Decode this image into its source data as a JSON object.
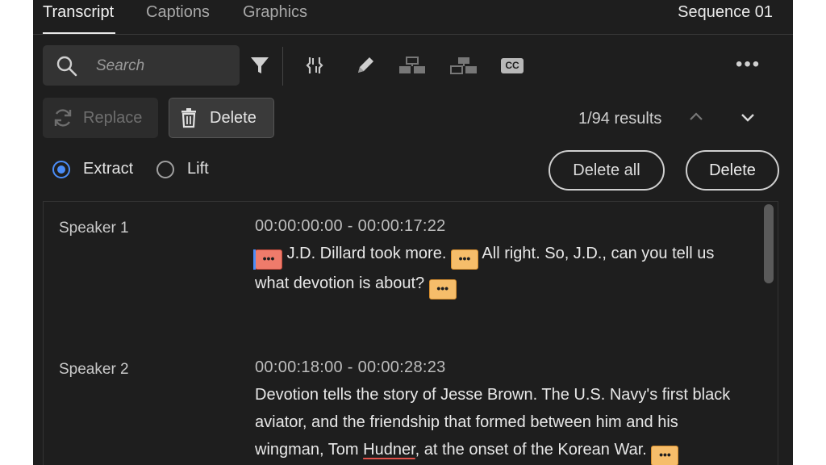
{
  "tabs": [
    {
      "label": "Transcript",
      "active": true
    },
    {
      "label": "Captions",
      "active": false
    },
    {
      "label": "Graphics",
      "active": false
    }
  ],
  "sequence_name": "Sequence 01",
  "search": {
    "placeholder": "Search",
    "value": ""
  },
  "toolbar": {
    "icons": [
      "search-icon",
      "filter-icon",
      "merge-segments-icon",
      "pencil-icon",
      "split-speaker-icon",
      "merge-speaker-icon",
      "closed-captions-icon",
      "more-icon"
    ],
    "cc_label": "CC",
    "more_label": "•••"
  },
  "actions": {
    "replace_label": "Replace",
    "delete_label": "Delete",
    "results": "1/94 results"
  },
  "mode": {
    "extract_label": "Extract",
    "lift_label": "Lift",
    "selected": "Extract"
  },
  "buttons": {
    "delete_all_label": "Delete all",
    "delete_label": "Delete"
  },
  "pause_marker": "•••",
  "segments": [
    {
      "speaker": "Speaker 1",
      "timecode": "00:00:00:00 - 00:00:17:22",
      "parts": [
        "J.D. Dillard took more.",
        "All right. So, J.D., can you tell us what devotion is about?"
      ]
    },
    {
      "speaker": "Speaker 2",
      "timecode": "00:00:18:00 - 00:00:28:23",
      "parts": [
        "Devotion tells the story of Jesse Brown. The U.S. Navy's first black aviator, and the friendship that formed between him and his wingman, Tom ",
        "Hudner",
        ", at the onset of the Korean War."
      ]
    }
  ],
  "colors": {
    "panel_bg": "#1e1e1e",
    "accent_blue": "#4b8df8",
    "pause_marker": "#f6bd6a",
    "selected_pause": "#ef7b6b"
  }
}
